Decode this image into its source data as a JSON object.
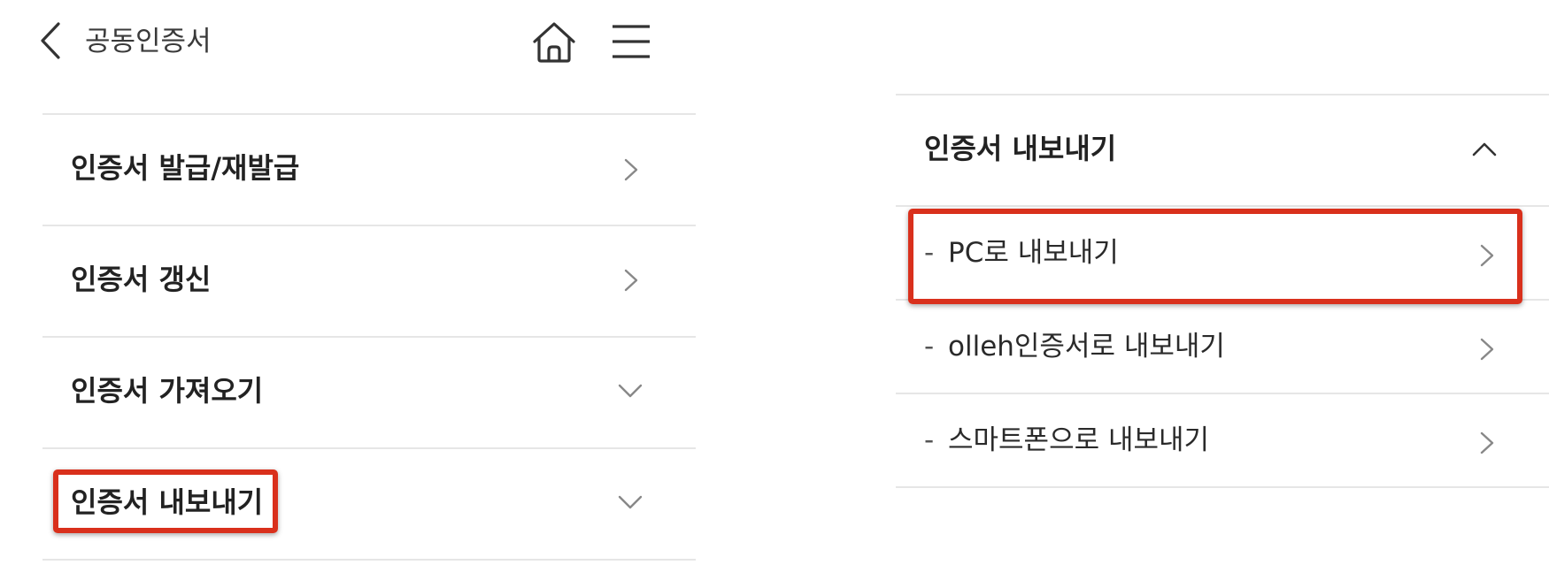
{
  "header": {
    "title": "공동인증서",
    "back_icon": "chevron-left-icon",
    "home_icon": "home-icon",
    "menu_icon": "hamburger-menu-icon"
  },
  "menu": {
    "items": [
      {
        "label": "인증서 발급/재발급",
        "icon": "chevron-right-icon"
      },
      {
        "label": "인증서 갱신",
        "icon": "chevron-right-icon"
      },
      {
        "label": "인증서 가져오기",
        "icon": "chevron-down-icon"
      },
      {
        "label": "인증서 내보내기",
        "icon": "chevron-down-icon"
      }
    ]
  },
  "export_panel": {
    "title": "인증서 내보내기",
    "toggle_icon": "chevron-up-icon",
    "dash": "-",
    "items": [
      {
        "label": "PC로 내보내기",
        "icon": "chevron-right-icon"
      },
      {
        "label": "olleh인증서로 내보내기",
        "icon": "chevron-right-icon"
      },
      {
        "label": "스마트폰으로 내보내기",
        "icon": "chevron-right-icon"
      }
    ]
  },
  "colors": {
    "highlight": "#d9301c",
    "divider": "#e6e6e6",
    "text": "#222222",
    "chevron": "#888888"
  }
}
